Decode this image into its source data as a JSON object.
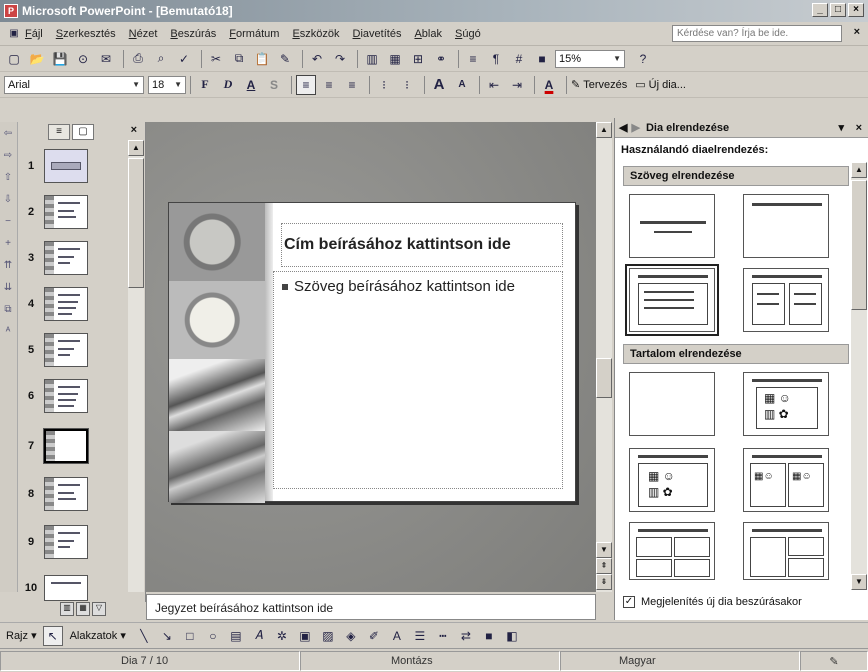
{
  "window": {
    "title": "Microsoft PowerPoint - [Bemutató18]",
    "controls": [
      "_",
      "□",
      "×"
    ]
  },
  "menu": {
    "items": [
      "Fájl",
      "Szerkesztés",
      "Nézet",
      "Beszúrás",
      "Formátum",
      "Eszközök",
      "Diavetítés",
      "Ablak",
      "Súgó"
    ],
    "help_placeholder": "Kérdése van? Írja be ide.",
    "help_close": "×"
  },
  "toolbar_standard": {
    "zoom": "15%",
    "help_glyph": "?"
  },
  "toolbar_format": {
    "font": "Arial",
    "size": "18",
    "bold_glyph": "F",
    "italic_glyph": "D",
    "underline_glyph": "A",
    "shadow_glyph": "S",
    "increase_font_glyph": "A",
    "decrease_font_glyph": "A",
    "font_color_glyph": "A",
    "design_label": "Tervezés",
    "new_slide_label": "Új dia..."
  },
  "slides_panel": {
    "close": "×",
    "thumbnails": [
      "1",
      "2",
      "3",
      "4",
      "5",
      "6",
      "7",
      "8",
      "9",
      "10"
    ],
    "selected": "7"
  },
  "slide": {
    "title_placeholder": "Cím beírásához kattintson ide",
    "body_placeholder": "Szöveg beírásához kattintson ide"
  },
  "notes": {
    "placeholder": "Jegyzet beírásához kattintson ide"
  },
  "task_pane": {
    "title": "Dia elrendezése",
    "close": "×",
    "subtitle": "Használandó diaelrendezés:",
    "section_text": "Szöveg elrendezése",
    "section_content": "Tartalom elrendezése",
    "show_on_insert": "Megjelenítés új dia beszúrásakor",
    "show_on_insert_checked": true,
    "check_glyph": "✓"
  },
  "drawing_toolbar": {
    "draw_label": "Rajz",
    "autoshapes_label": "Alakzatok"
  },
  "status": {
    "slide_counter": "Dia 7 / 10",
    "design": "Montázs",
    "language": "Magyar"
  }
}
